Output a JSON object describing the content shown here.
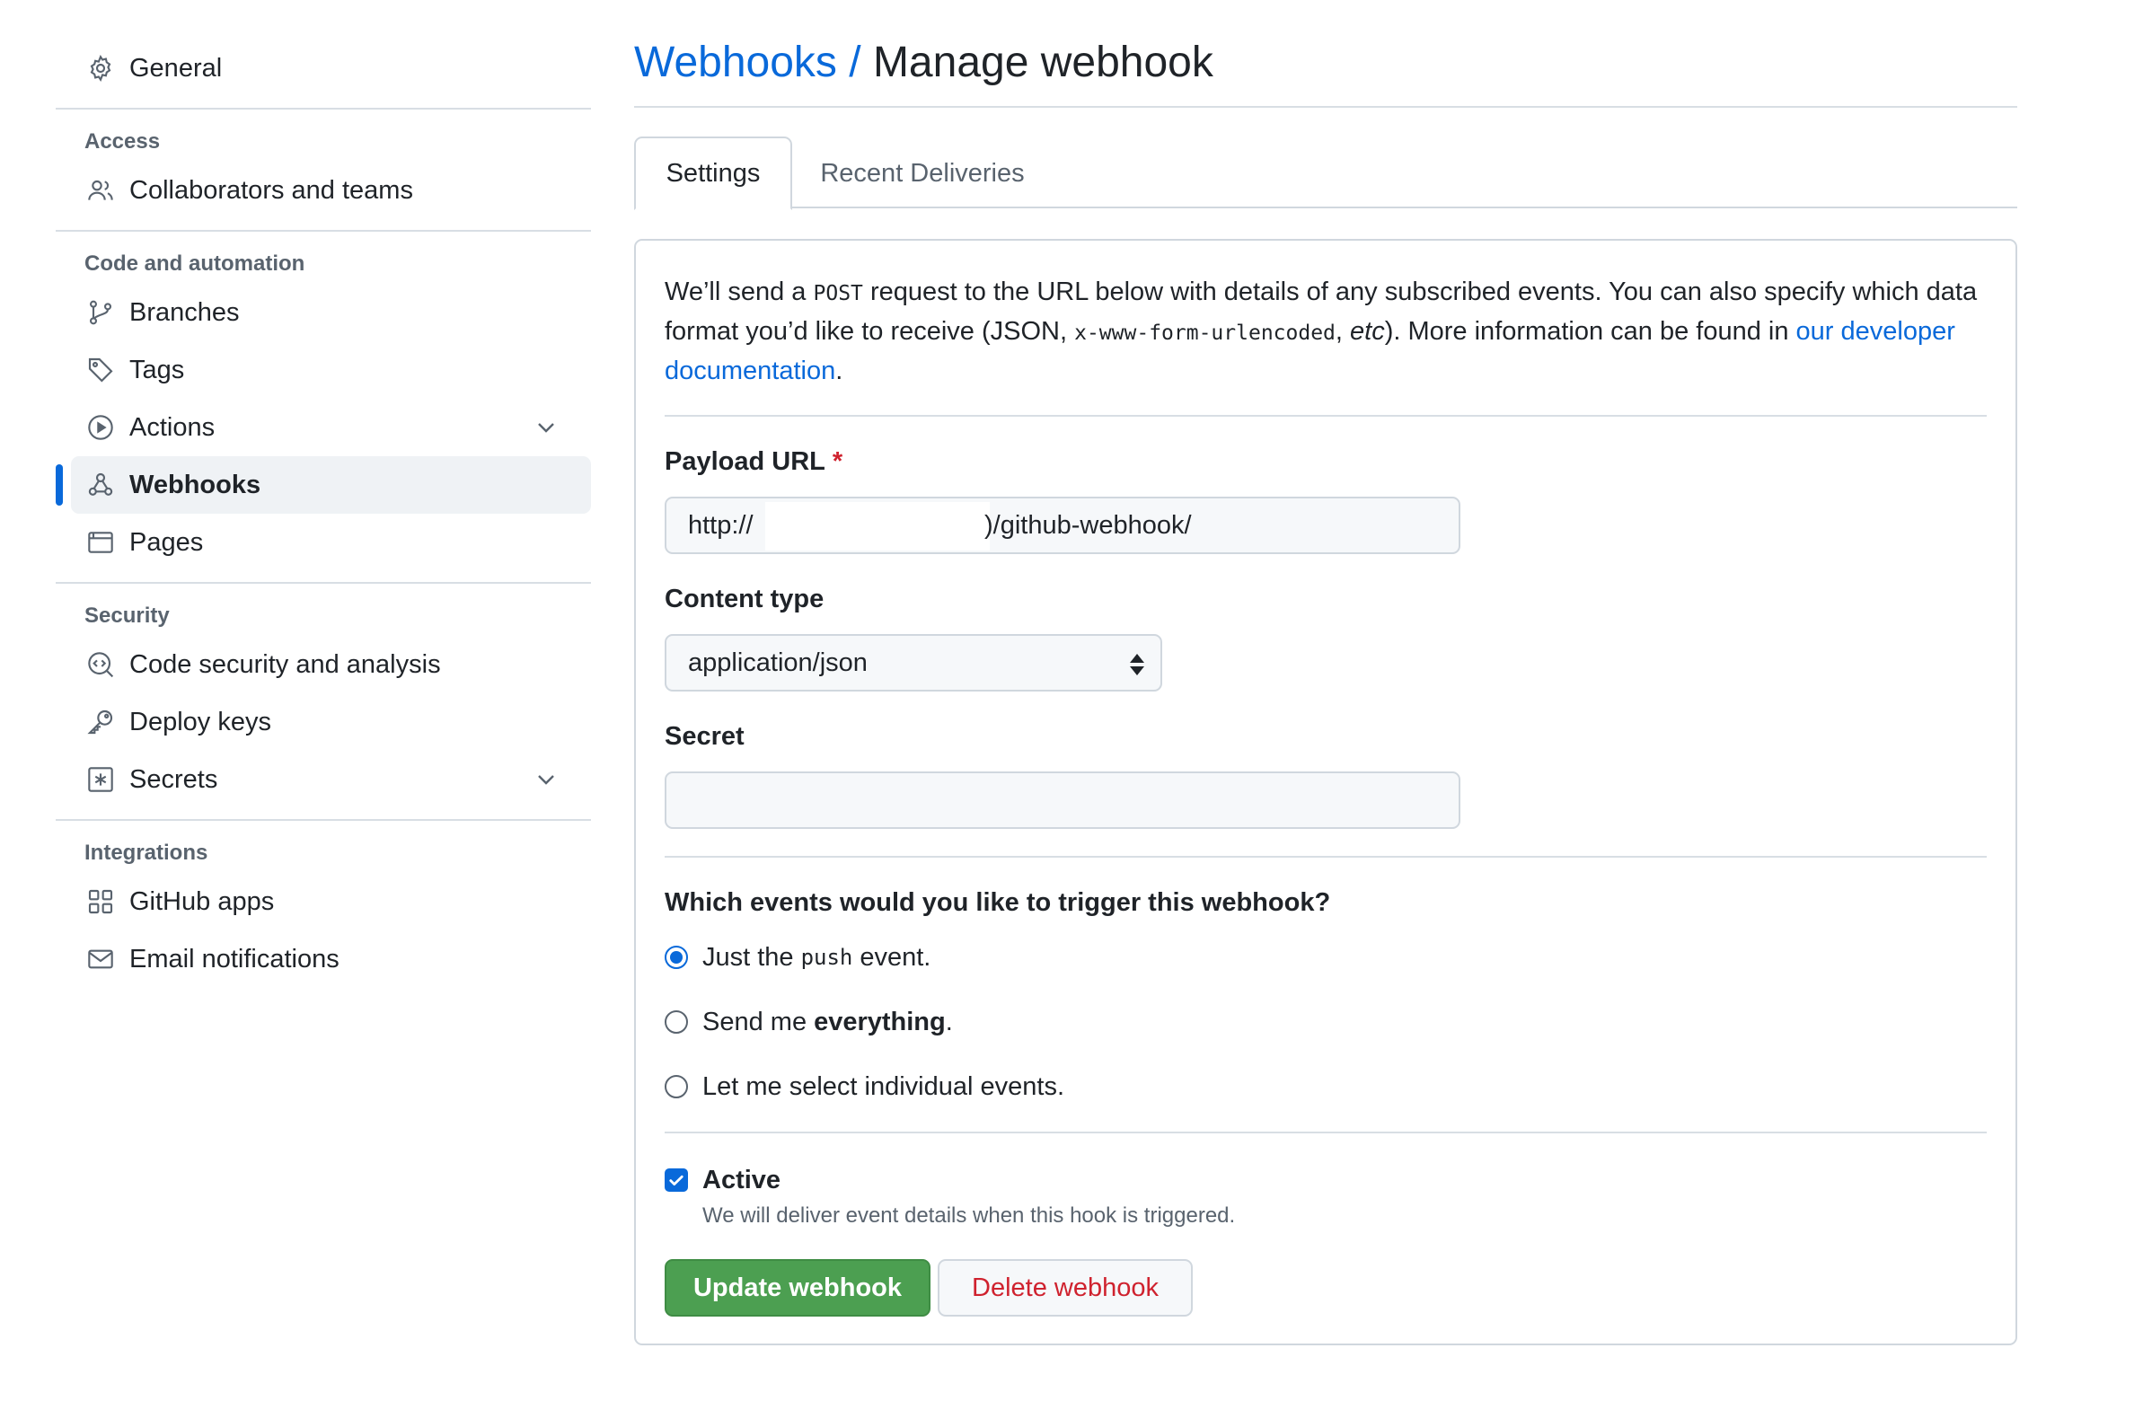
{
  "sidebar": {
    "general": "General",
    "sections": [
      {
        "heading": "Access",
        "items": [
          "Collaborators and teams"
        ]
      },
      {
        "heading": "Code and automation",
        "items": [
          "Branches",
          "Tags",
          "Actions",
          "Webhooks",
          "Pages"
        ]
      },
      {
        "heading": "Security",
        "items": [
          "Code security and analysis",
          "Deploy keys",
          "Secrets"
        ]
      },
      {
        "heading": "Integrations",
        "items": [
          "GitHub apps",
          "Email notifications"
        ]
      }
    ],
    "active_item": "Webhooks"
  },
  "page": {
    "breadcrumb_link": "Webhooks",
    "breadcrumb_sep": " / ",
    "title": "Manage webhook"
  },
  "tabs": {
    "settings": "Settings",
    "recent": "Recent Deliveries"
  },
  "intro": {
    "p1": "We’ll send a ",
    "code1": "POST",
    "p2": " request to the URL below with details of any subscribed events. You can also specify which data format you’d like to receive (JSON, ",
    "code2": "x-www-form-urlencoded",
    "p3": ", ",
    "em": "etc",
    "p4": "). More information can be found in ",
    "link": "our developer documentation",
    "p5": "."
  },
  "form": {
    "payload_label": "Payload URL",
    "required_mark": "*",
    "payload_prefix": "http://",
    "payload_suffix": ")/github-webhook/",
    "content_type_label": "Content type",
    "content_type_value": "application/json",
    "secret_label": "Secret",
    "secret_value": ""
  },
  "events": {
    "question": "Which events would you like to trigger this webhook?",
    "opt1_a": "Just the",
    "opt1_code": "push",
    "opt1_b": "event.",
    "opt2_a": "Send me",
    "opt2_bold": "everything",
    "opt2_b": ".",
    "opt3": "Let me select individual events.",
    "selected": 0
  },
  "active": {
    "label": "Active",
    "note": "We will deliver event details when this hook is triggered.",
    "checked": true
  },
  "buttons": {
    "update": "Update webhook",
    "delete": "Delete webhook"
  },
  "colors": {
    "accent": "#0969da",
    "primary_button": "#4c9f51",
    "danger_text": "#cf222e"
  }
}
